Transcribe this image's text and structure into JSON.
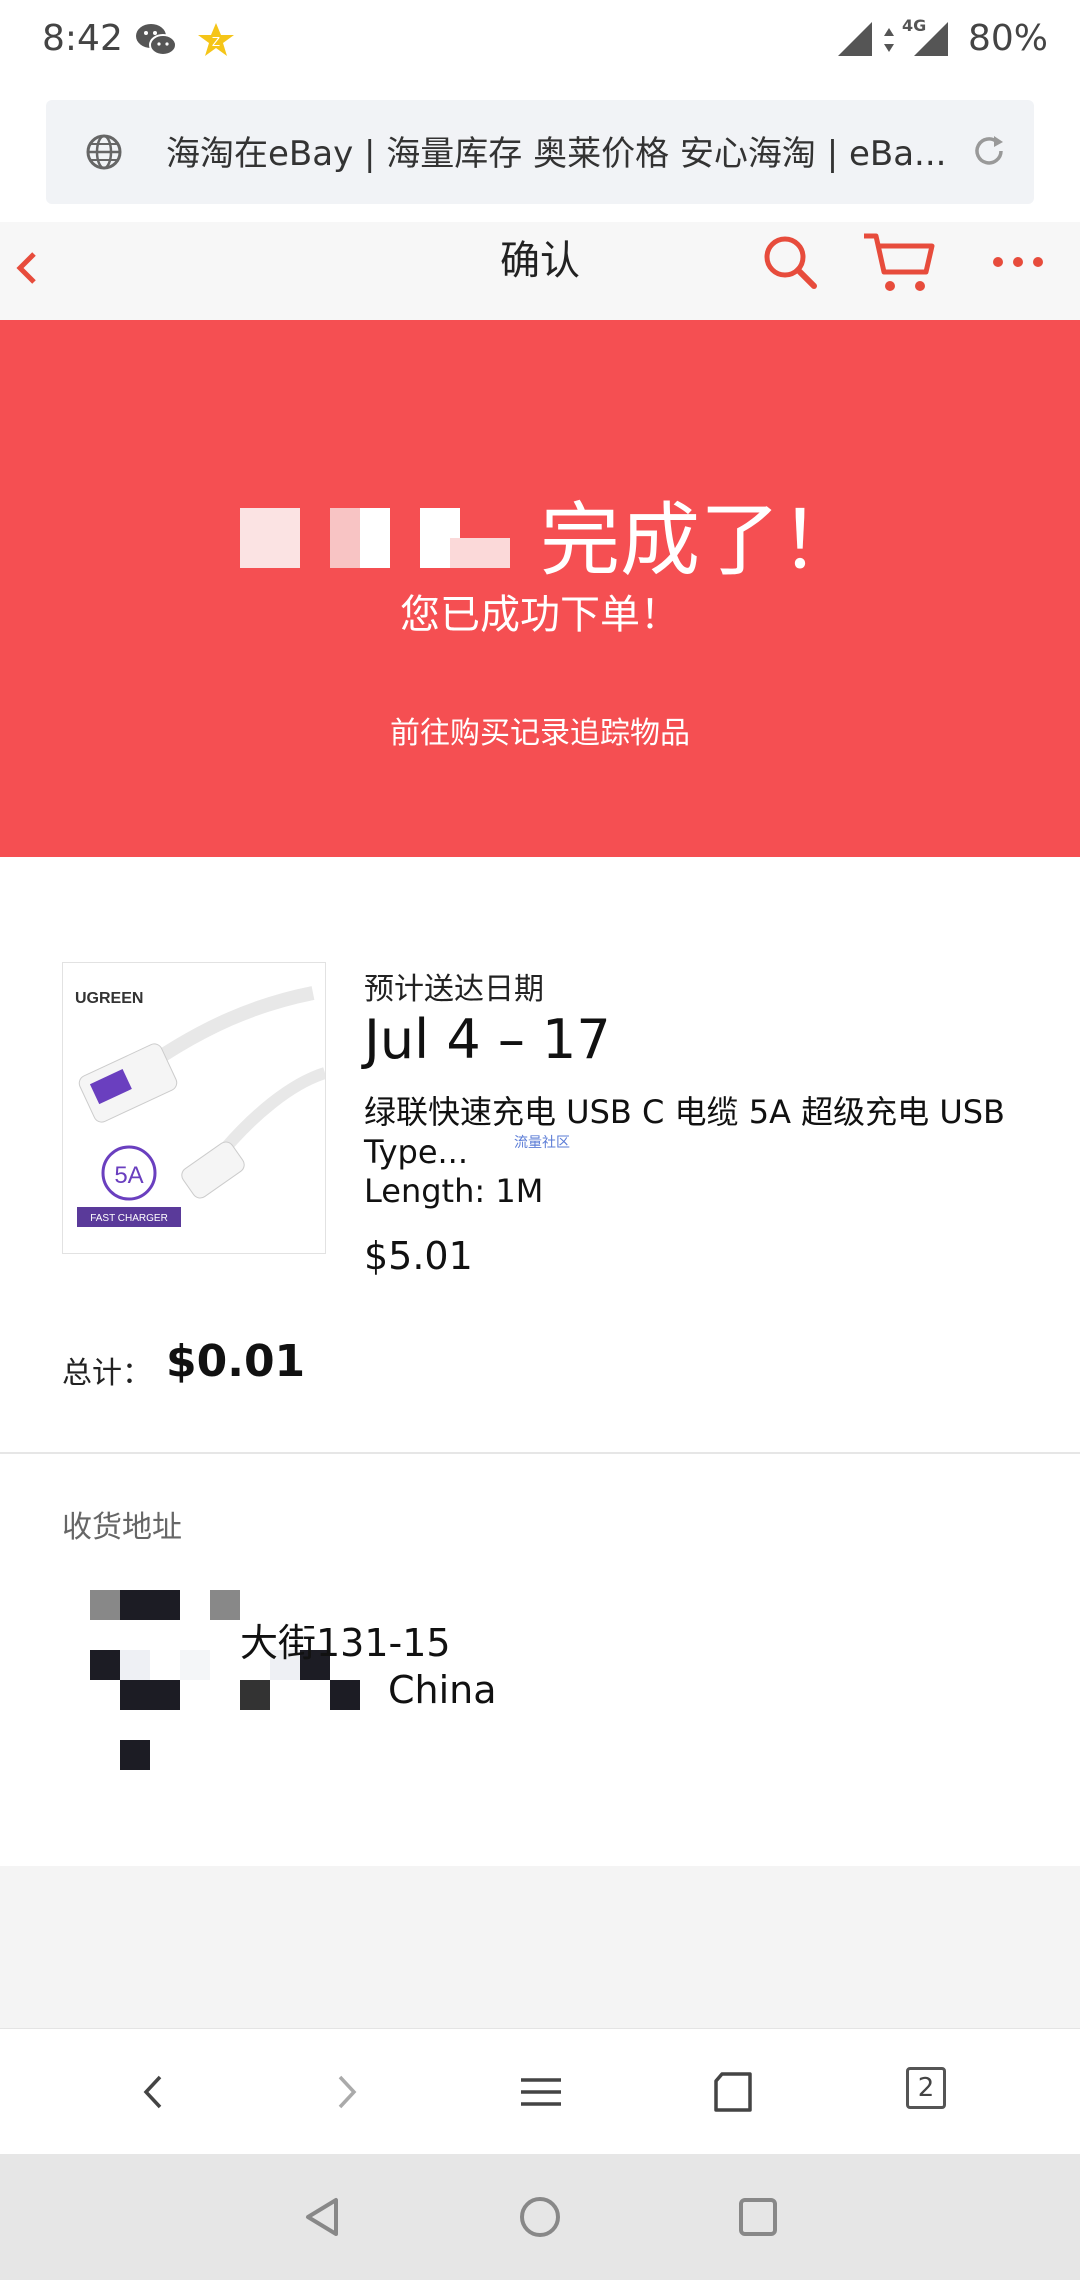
{
  "status_bar": {
    "time": "8:42",
    "network": "4G",
    "battery": "80%",
    "icons": [
      "wechat-icon",
      "star-notification-icon",
      "signal-icon",
      "data-arrows-icon",
      "signal-4g-icon"
    ]
  },
  "browser": {
    "url_title": "海淘在eBay | 海量库存 奥莱价格 安心海淘 | eBa...",
    "tab_count": "2"
  },
  "header": {
    "title": "确认"
  },
  "banner": {
    "title": "完成了！",
    "subtitle": "您已成功下单！",
    "track_link": "前往购买记录追踪物品",
    "color": "#f54f52"
  },
  "order": {
    "delivery_label": "预计送达日期",
    "delivery_date": "Jul 4 – 17",
    "item_title": "绿联快速充电 USB C 电缆 5A 超级充电 USB Type...",
    "item_variant": "Length: 1M",
    "item_price": "$5.01",
    "total_label": "总计：",
    "total_value": "$0.01",
    "watermark": "流量社区",
    "image": {
      "brand": "UGREEN",
      "badge": "5A",
      "caption": "FAST CHARGER"
    }
  },
  "address": {
    "heading": "收货地址",
    "line1": "大街131-15",
    "country": "China"
  },
  "accent_color": "#e74c3c"
}
